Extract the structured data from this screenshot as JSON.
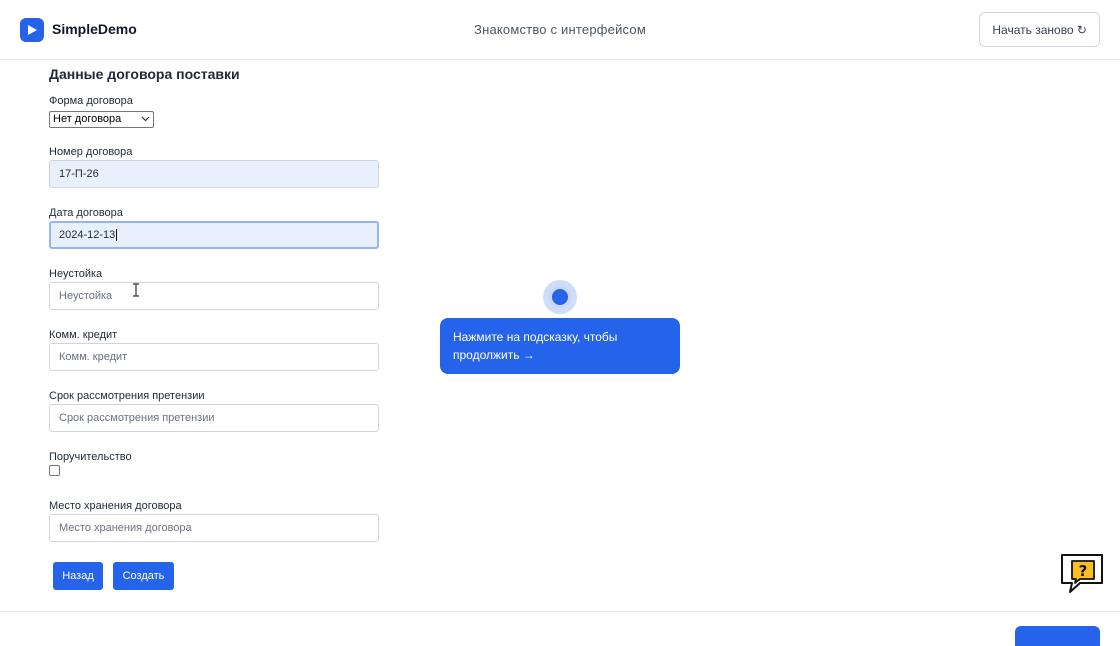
{
  "header": {
    "brand": "SimpleDemo",
    "title": "Знакомство с интерфейсом",
    "restart_label": "Начать заново ↻"
  },
  "form": {
    "title": "Данные договора поставки",
    "contract_form": {
      "label": "Форма договора",
      "value": "Нет договора"
    },
    "contract_number": {
      "label": "Номер договора",
      "value": "17-П-26"
    },
    "contract_date": {
      "label": "Дата договора",
      "value": "2024-12-13"
    },
    "penalty": {
      "label": "Неустойка",
      "placeholder": "Неустойка"
    },
    "commercial_credit": {
      "label": "Комм. кредит",
      "placeholder": "Комм. кредит"
    },
    "claim_period": {
      "label": "Срок рассмотрения претензии",
      "placeholder": "Срок рассмотрения претензии"
    },
    "guarantee": {
      "label": "Поручительство",
      "checked": false
    },
    "storage_place": {
      "label": "Место хранения договора",
      "placeholder": "Место хранения договора"
    },
    "back_label": "Назад",
    "create_label": "Создать"
  },
  "hint": {
    "text": "Нажмите на подсказку, чтобы продолжить →"
  },
  "icons": {
    "logo": "play-icon",
    "help": "question-bubble-icon",
    "cursor": "text-cursor-icon"
  },
  "colors": {
    "accent": "#2563eb",
    "filled_field": "#e8f0fe"
  }
}
